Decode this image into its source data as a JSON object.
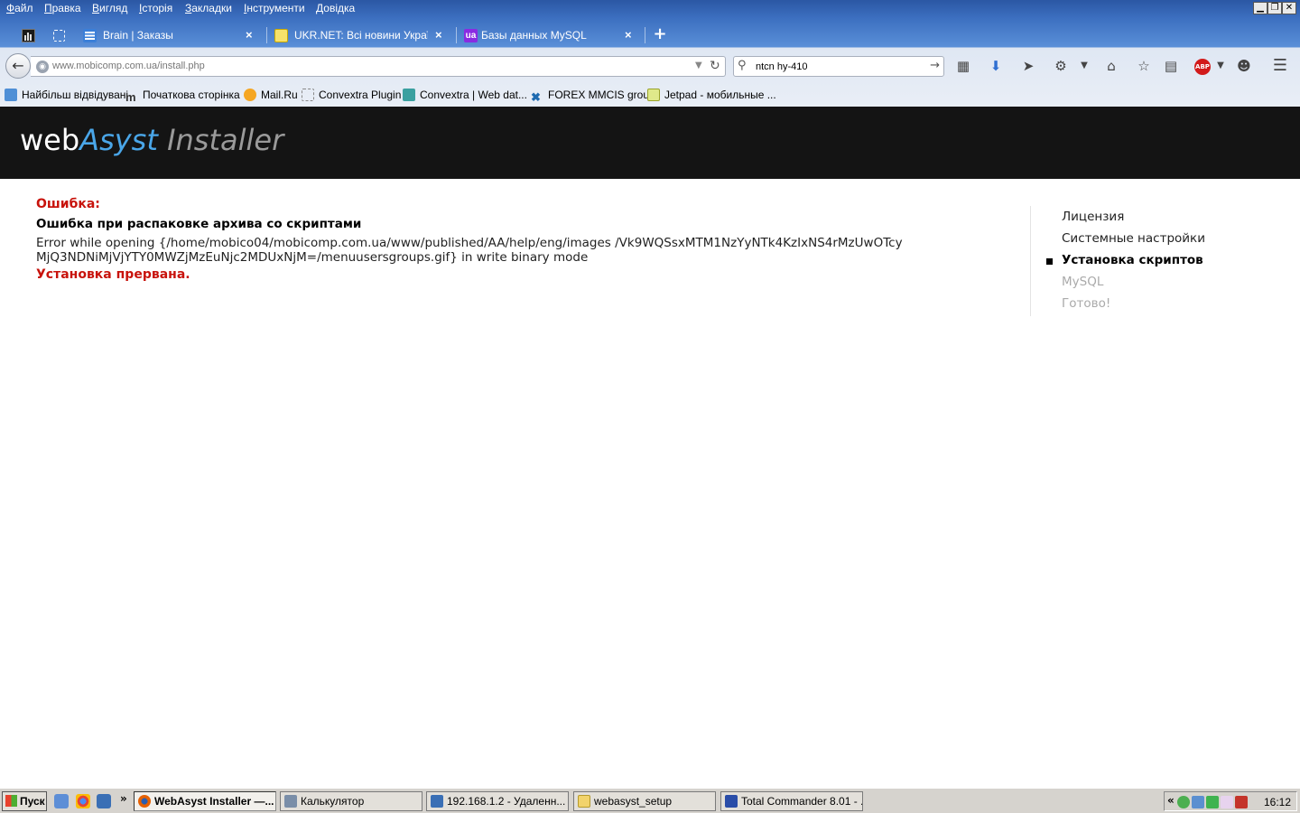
{
  "menubar": {
    "items": [
      "Файл",
      "Правка",
      "Вигляд",
      "Історія",
      "Закладки",
      "Інструменти",
      "Довідка"
    ]
  },
  "window_controls": {
    "minimize": "▁",
    "restore": "❐",
    "close": "✕"
  },
  "tabs": [
    {
      "title": "Brain | Заказы",
      "icon": "brain-icon",
      "color": "#3b7fd8"
    },
    {
      "title": "UKR.NET: Всі новини Украї...",
      "icon": "ukrnet-icon",
      "color": "#f7c600"
    },
    {
      "title": "Базы данных MySQL",
      "icon": "ua-hosting-icon",
      "color": "#8a2be2"
    }
  ],
  "new_tab_label": "+",
  "tab_close_glyph": "×",
  "navbar": {
    "url_host": "www.mobicomp.com.ua",
    "url_path": "/install.php",
    "search_value": "ntcn hy-410"
  },
  "bookmarks": [
    {
      "label": "Найбільш відвідувані",
      "icon": "most-visited-icon",
      "color": "#4f8fd6"
    },
    {
      "label": "Початкова сторінка",
      "icon": "meta-m-icon",
      "color": "#333333"
    },
    {
      "label": "Mail.Ru",
      "icon": "mailru-icon",
      "color": "#1d6fc2"
    },
    {
      "label": "Convextra Plugin",
      "icon": "blank-page-icon",
      "color": "#ffffff"
    },
    {
      "label": "Convextra | Web dat...",
      "icon": "convextra-icon",
      "color": "#3aa0a0"
    },
    {
      "label": "FOREX MMCIS group",
      "icon": "forex-icon",
      "color": "#1e6ab0"
    },
    {
      "label": "Jetpad - мобильные ...",
      "icon": "jetpad-icon",
      "color": "#b9c93a"
    }
  ],
  "page": {
    "logo": {
      "web": "web",
      "asyst": "Asyst",
      "installer": " Installer"
    },
    "error_label": "Ошибка:",
    "error_title": "Ошибка при распаковке архива со скриптами",
    "error_details": "Error while opening {/home/mobico04/mobicomp.com.ua/www/published/AA/help/eng/images /Vk9WQSsxMTM1NzYyNTk4KzIxNS4rMzUwOTcyMjQ3NDNiMjVjYTY0MWZjMzEuNjc2MDUxNjM=/menuusersgroups.gif} in write binary mode",
    "error_abort": "Установка прервана.",
    "steps": [
      {
        "label": "Лицензия",
        "state": "done"
      },
      {
        "label": "Системные настройки",
        "state": "done"
      },
      {
        "label": "Установка скриптов",
        "state": "active"
      },
      {
        "label": "MySQL",
        "state": "pending"
      },
      {
        "label": "Готово!",
        "state": "pending"
      }
    ]
  },
  "taskbar": {
    "start_label": "Пуск",
    "quicklaunch_more": "»",
    "tasks": [
      {
        "label": "WebAsyst Installer —...",
        "icon": "firefox-icon",
        "color": "#e66000",
        "active": true
      },
      {
        "label": "Калькулятор",
        "icon": "calculator-icon",
        "color": "#7a8ea8",
        "active": false
      },
      {
        "label": "192.168.1.2 - Удаленн...",
        "icon": "remote-desktop-icon",
        "color": "#3a6fb5",
        "active": false
      },
      {
        "label": "webasyst_setup",
        "icon": "folder-icon",
        "color": "#f2d36b",
        "active": false
      },
      {
        "label": "Total Commander 8.01 - ...",
        "icon": "total-commander-icon",
        "color": "#2a4da8",
        "active": false
      }
    ],
    "tray_chevron": "«",
    "clock": "16:12"
  }
}
